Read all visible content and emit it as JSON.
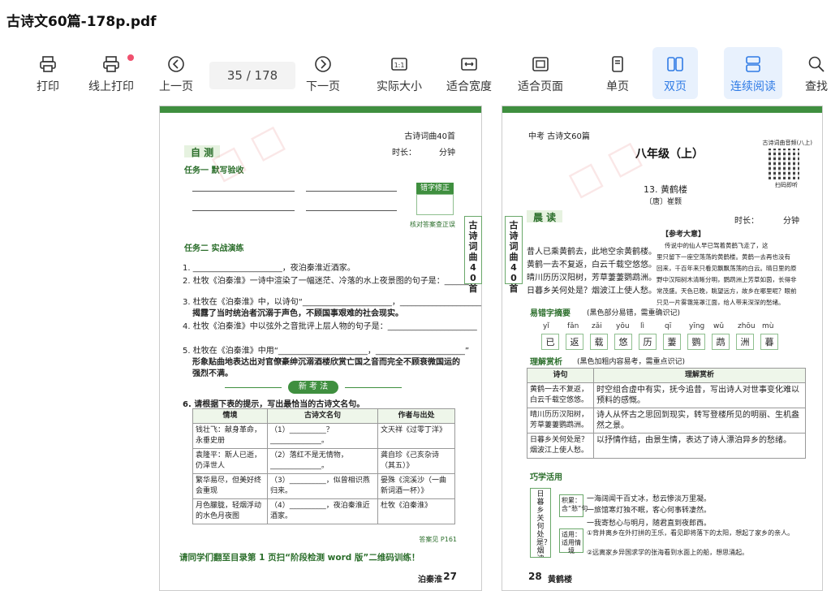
{
  "window": {
    "title": "古诗文60篇-178p.pdf"
  },
  "toolbar": {
    "print": "打印",
    "online_print": "线上打印",
    "prev_page": "上一页",
    "page_indicator": "35 / 178",
    "next_page": "下一页",
    "actual_size": "实际大小",
    "fit_width": "适合宽度",
    "fit_page": "适合页面",
    "single_page": "单页",
    "double_page": "双页",
    "continuous": "连续阅读",
    "search": "查找"
  },
  "left_page": {
    "header": "古诗词曲40首",
    "time_label": "时长：",
    "time_unit": "分钟",
    "section_title": "自 测",
    "task1": "任务一  默写验收",
    "correction_box": "错字修正",
    "correction_note": "核对答案查正误",
    "task2": "任务二  实战演练",
    "side_tab": "古诗词曲40首",
    "q1": "1. ______________________，夜泊秦淮近酒家。",
    "q2": "2. 杜牧《泊秦淮》一诗中渲染了一幅迷茫、冷落的水上夜景图的句子是：______",
    "q3a": "3. 杜牧在《泊秦淮》中，以诗句“______________________，______________________”",
    "q3b": "揭露了当时统治者沉溺于声色，不顾国事艰难的社会现实。",
    "q4": "4. 杜牧《泊秦淮》中以弦外之音批评上层人物的句子是：______________________",
    "q5a": "5. 杜牧在《泊秦淮》中用“______________________，______________________”",
    "q5b": "形象贴曲地表达出对官僚豪绅沉溺酒楼欣赏亡国之音而完全不顾衰微国运的",
    "q5c": "强烈不满。",
    "new_exam": "新 考 法",
    "q6": "6. 请根据下表的提示，写出最恰当的古诗文名句。",
    "table_headers": [
      "情境",
      "古诗文名句",
      "作者与出处"
    ],
    "table_rows": [
      [
        "钱壮飞：献身革命，永垂史册",
        "（1）__________？______________。",
        "文天祥《过零丁洋》"
      ],
      [
        "袁隆平：斯人已逝，仍泽世人",
        "（2）落红不是无情物，______________。",
        "龚自珍《己亥杂诗（其五）》"
      ],
      [
        "繁华易尽，但美好终会重现",
        "（3）__________，似曾相识燕归来。",
        "晏殊《浣溪沙（一曲新词酒一杯）》"
      ],
      [
        "月色朦胧，轻烟浮动的水色月夜图",
        "（4）__________，夜泊秦淮近酒家。",
        "杜牧《泊秦淮》"
      ]
    ],
    "answer_ref": "答案见 P161",
    "footer_note": "请同学们翻至目录第 1 页扫“阶段检测 word 版”二维码训练！",
    "page_label": "泊秦淮",
    "page_number": "27"
  },
  "right_page": {
    "header": "中考 古诗文60篇",
    "grade": "八年级（上）",
    "qr_caption": "古诗词曲音频(八上)",
    "qr_scan": "扫码即听",
    "poem_title": "13. 黄鹤楼",
    "poem_author": "〔唐〕崔颢",
    "section_read": "晨 读",
    "time_label": "时长：",
    "time_unit": "分钟",
    "side_tab": "古诗词曲40首",
    "poem_lines": [
      "昔人已乘黄鹤去，此地空余黄鹤楼。",
      "黄鹤一去不复返，白云千载空悠悠。",
      "晴川历历汉阳树，芳草萋萋鹦鹉洲。",
      "日暮乡关何处是？烟波江上使人愁。"
    ],
    "meaning_title": "【参考大意】",
    "meaning_lines": [
      "传说中的仙人早已驾着黄鹤飞走了，这",
      "里只留下一座空荡荡的黄鹤楼。黄鹤一去再也没有",
      "回来，千百年来只看见飘飘荡荡的白云。晴日里的原",
      "野中汉阳树木清晰分明，鹦鹉洲上芳草如茵，长得非",
      "常茂盛。天色已晚，眺望远方，故乡在哪里呢？眼前",
      "只见一片雾霭笼罩江面，给人带来深深的愁绪。"
    ],
    "typo_title": "易错字摘要",
    "typo_note": "(黑色部分易错，需重确识记)",
    "pinyin": [
      "yǐ",
      "fǎn",
      "zǎi",
      "yōu",
      "lì",
      "qī",
      "yīng",
      "wǔ",
      "zhōu",
      "mù"
    ],
    "chars": [
      "已",
      "返",
      "载",
      "悠",
      "历",
      "萋",
      "鹦",
      "鹉",
      "洲",
      "暮"
    ],
    "appreciation_title": "理解赏析",
    "appreciation_note": "(黑色加粗内容易考，需重点识记)",
    "appr_headers": [
      "诗句",
      "理解赏析"
    ],
    "appr_rows": [
      [
        "黄鹤一去不复返，白云千载空悠悠。",
        "时空组合虚中有实，抚今追昔，写出诗人对世事变化难以预料的感慨。"
      ],
      [
        "晴川历历汉阳树，芳草萋萋鹦鹉洲。",
        "诗人从怀古之思回到现实，转写登楼所见的明丽、生机盎然之景。"
      ],
      [
        "日暮乡关何处是？烟波江上使人愁。",
        "以抒情作结，由景生情，表达了诗人漂泊异乡的愁绪。"
      ]
    ],
    "usage_title": "巧学活用",
    "usage_vertical": "日暮乡关何处是？烟波江上使人愁。",
    "usage_accumulate": "积累：含“愁”句",
    "usage_situation": "适用：适用情境",
    "usage_lines": [
      "一海阔闻干百丈冰，愁云惨淡万里凝。",
      "一旅馆寒灯独不眠，客心何事转凄然。",
      "一我寄愁心与明月，随君直到夜郎西。",
      "①背井离乡在外打拼的王乐，看见即将落下的太阳，想起了家乡的亲人。",
      "②远离家乡异国求学的张海看到水面上的船，想思涌起。"
    ],
    "page_number": "28",
    "page_label": "黄鹤楼"
  }
}
